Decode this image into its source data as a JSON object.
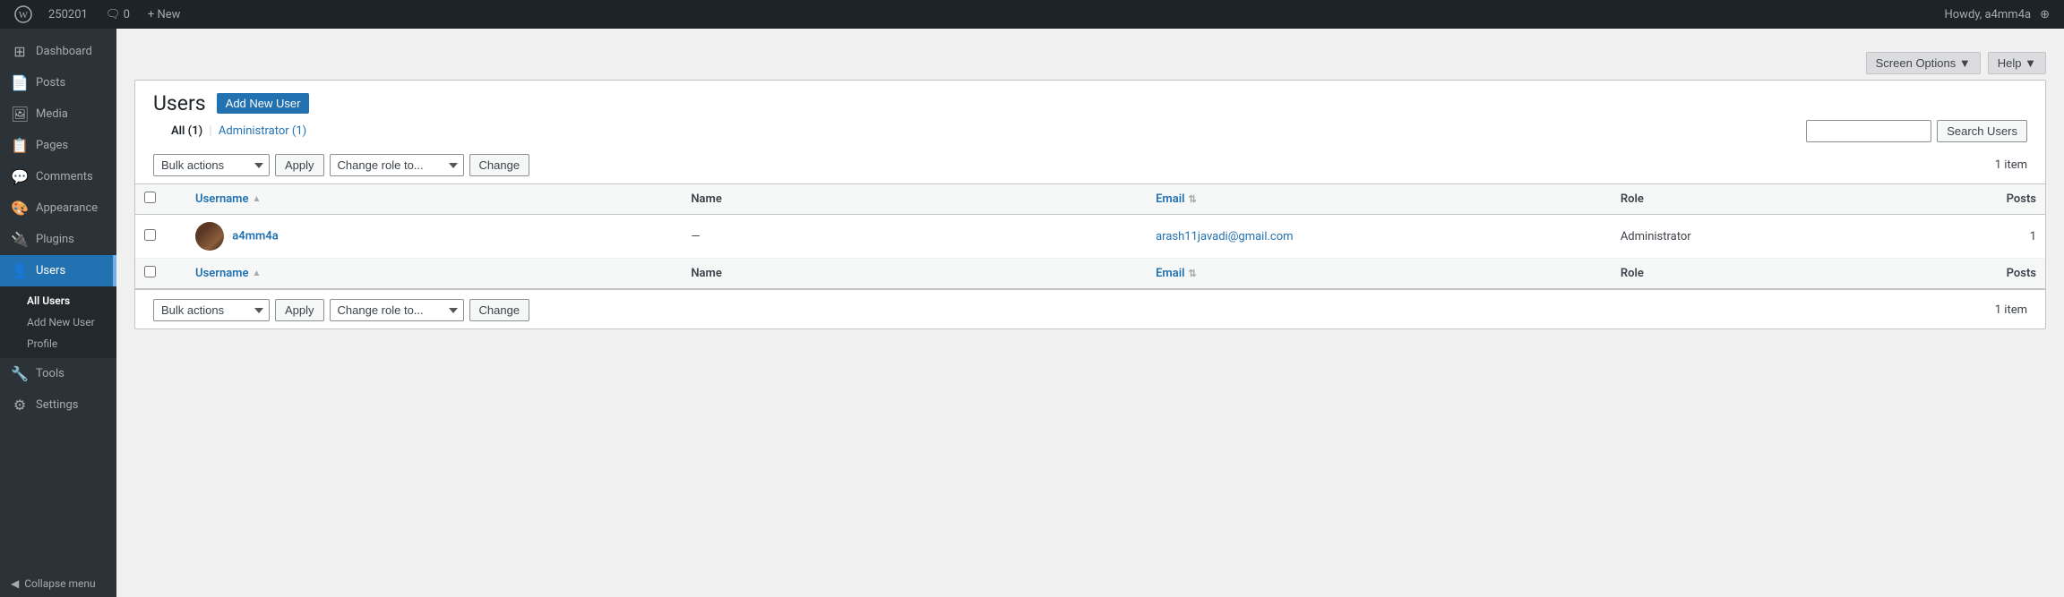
{
  "adminbar": {
    "wp_logo": "W",
    "site_name": "250201",
    "comments_icon": "💬",
    "comments_count": "0",
    "new_label": "+ New",
    "howdy": "Howdy, a4mm4a",
    "expand_icon": "⊕"
  },
  "sidebar": {
    "items": [
      {
        "id": "dashboard",
        "label": "Dashboard",
        "icon": "⊞"
      },
      {
        "id": "posts",
        "label": "Posts",
        "icon": "📄"
      },
      {
        "id": "media",
        "label": "Media",
        "icon": "🖼"
      },
      {
        "id": "pages",
        "label": "Pages",
        "icon": "📋"
      },
      {
        "id": "comments",
        "label": "Comments",
        "icon": "💬"
      },
      {
        "id": "appearance",
        "label": "Appearance",
        "icon": "🎨"
      },
      {
        "id": "plugins",
        "label": "Plugins",
        "icon": "🔌"
      },
      {
        "id": "users",
        "label": "Users",
        "icon": "👤",
        "active": true
      },
      {
        "id": "tools",
        "label": "Tools",
        "icon": "🔧"
      },
      {
        "id": "settings",
        "label": "Settings",
        "icon": "⚙"
      }
    ],
    "submenu": {
      "parent": "users",
      "items": [
        {
          "id": "all-users",
          "label": "All Users",
          "active": true
        },
        {
          "id": "add-new-user",
          "label": "Add New User"
        },
        {
          "id": "profile",
          "label": "Profile"
        }
      ]
    },
    "collapse_label": "Collapse menu"
  },
  "screen_meta": {
    "screen_options_label": "Screen Options",
    "screen_options_arrow": "▼",
    "help_label": "Help",
    "help_arrow": "▼"
  },
  "page": {
    "title": "Users",
    "add_new_label": "Add New User",
    "filter_links": [
      {
        "id": "all",
        "label": "All",
        "count": "(1)",
        "current": true
      },
      {
        "id": "administrator",
        "label": "Administrator",
        "count": "(1)",
        "current": false
      }
    ],
    "item_count_top": "1 item",
    "item_count_bottom": "1 item",
    "search_input_placeholder": "",
    "search_button_label": "Search Users",
    "bulk_actions_label": "Bulk actions",
    "apply_label": "Apply",
    "change_role_label": "Change role to...",
    "change_button_label": "Change",
    "table": {
      "columns": [
        {
          "id": "username",
          "label": "Username",
          "sortable": true,
          "sort_dir": "asc"
        },
        {
          "id": "name",
          "label": "Name",
          "sortable": false
        },
        {
          "id": "email",
          "label": "Email",
          "sortable": true,
          "sort_dir": "none"
        },
        {
          "id": "role",
          "label": "Role",
          "sortable": false
        },
        {
          "id": "posts",
          "label": "Posts",
          "sortable": false
        }
      ],
      "rows": [
        {
          "username": "a4mm4a",
          "name": "—",
          "email": "arash11javadi@gmail.com",
          "role": "Administrator",
          "posts": "1",
          "has_avatar": true
        }
      ]
    }
  }
}
